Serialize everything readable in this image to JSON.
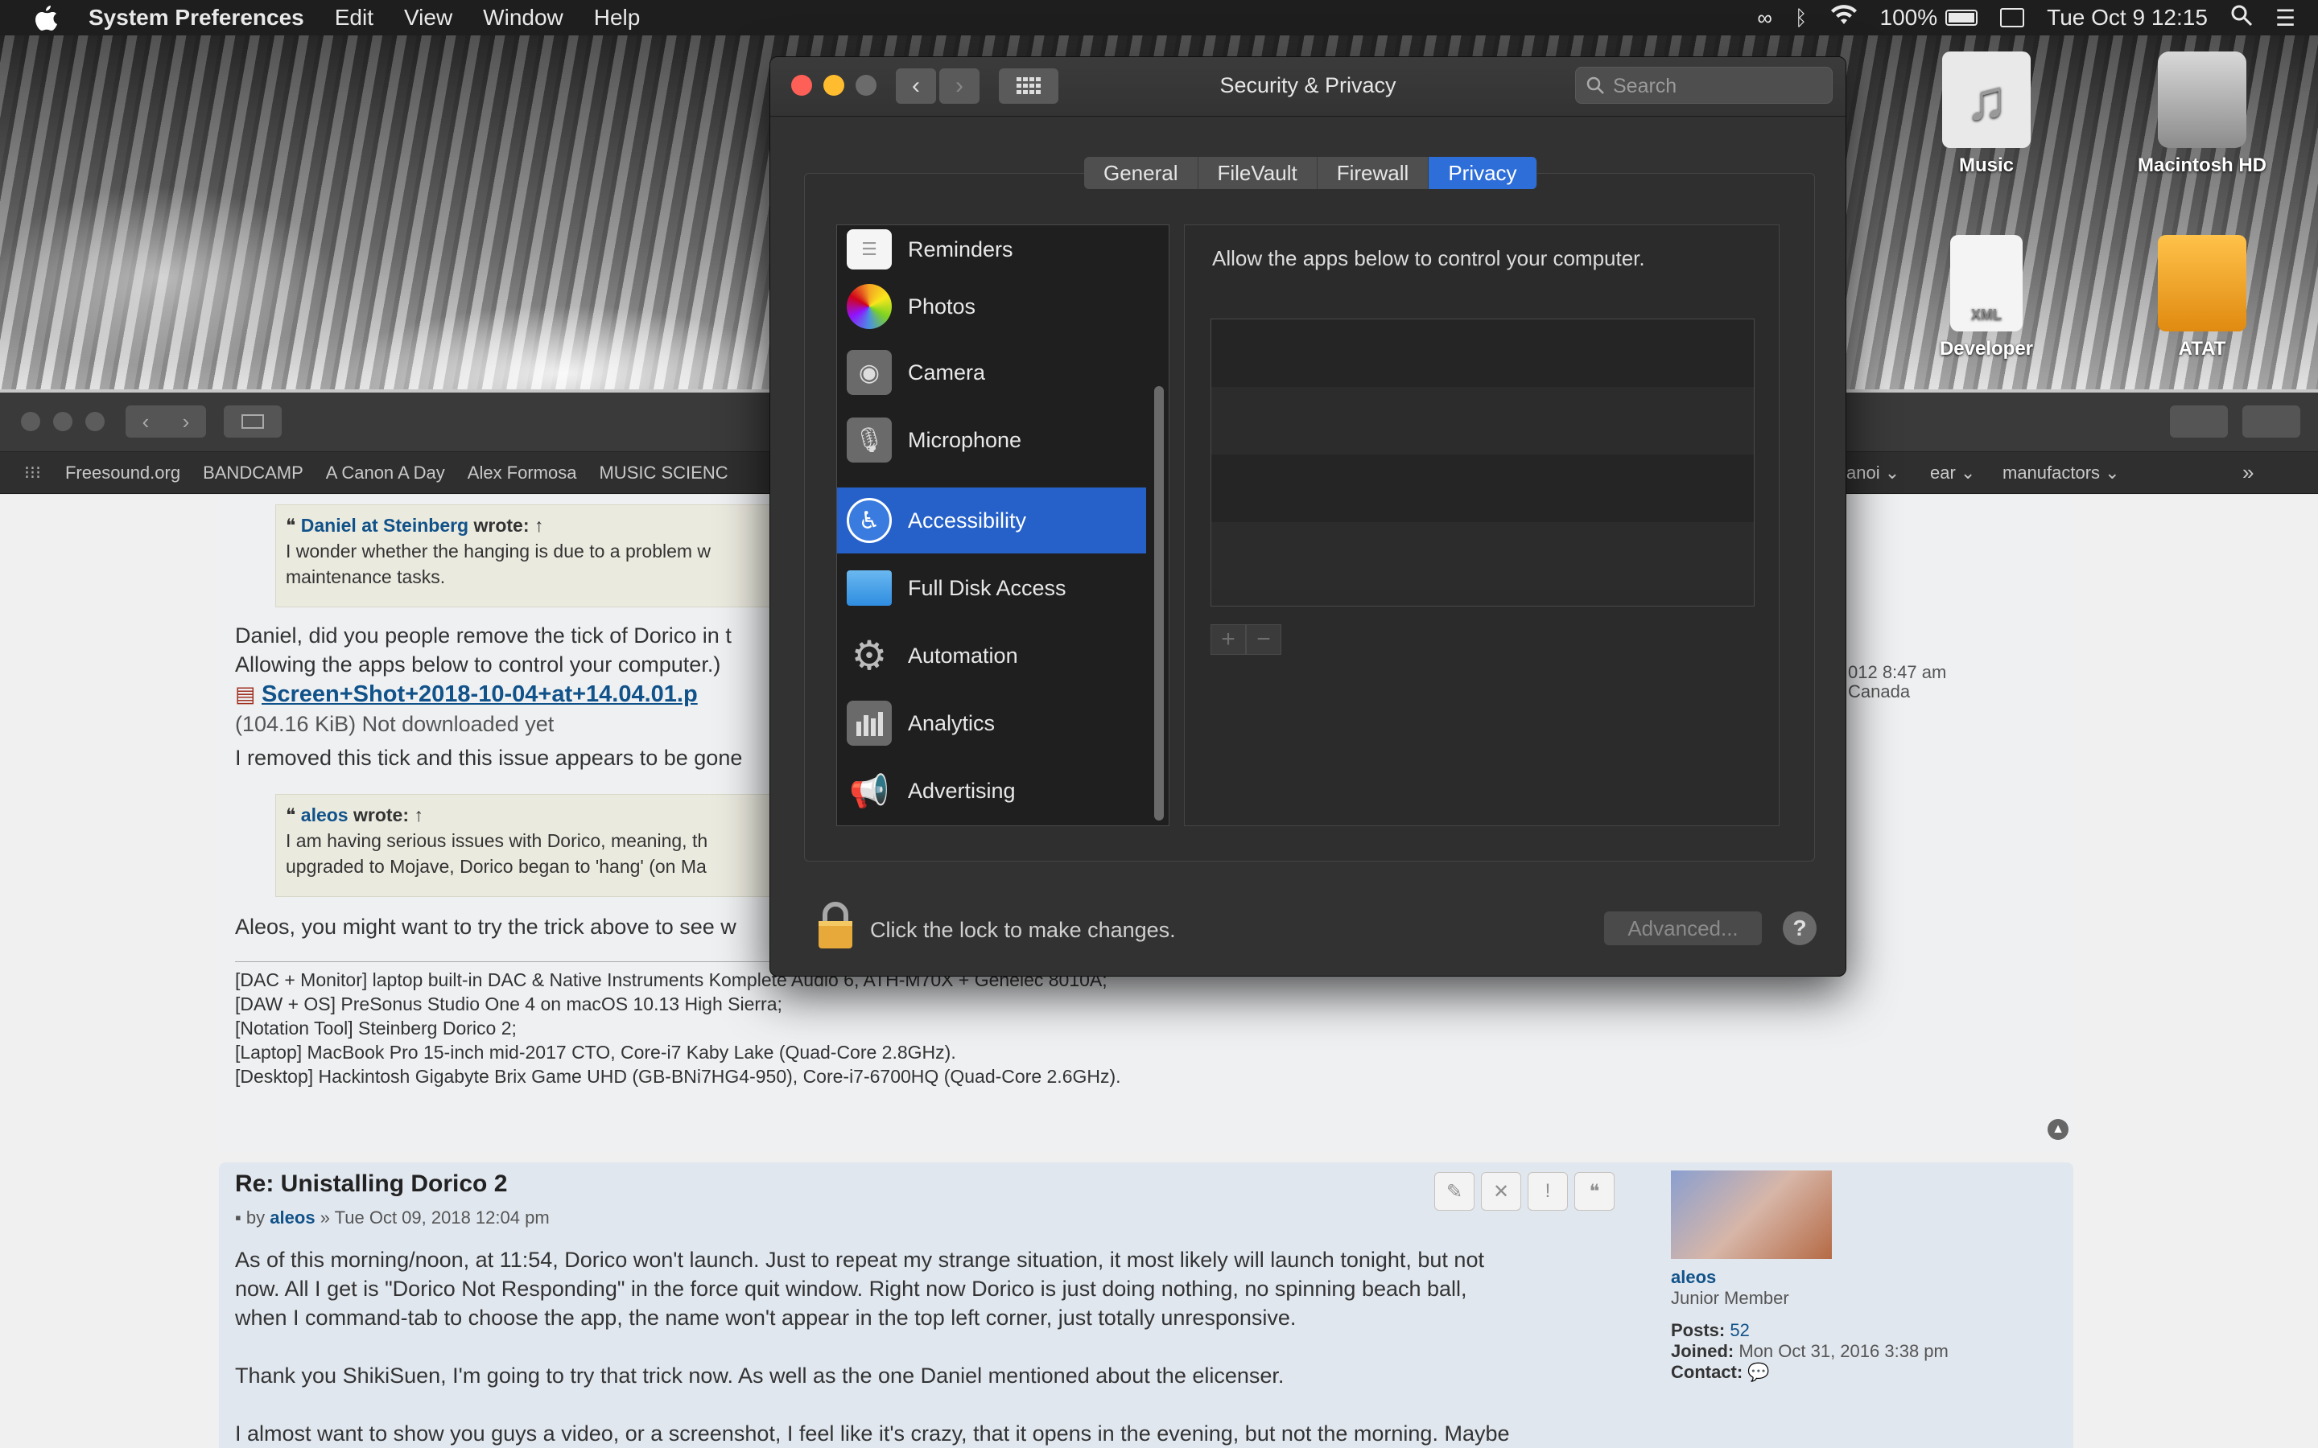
{
  "menubar": {
    "app_name": "System Preferences",
    "items": [
      "Edit",
      "View",
      "Window",
      "Help"
    ],
    "battery": "100%",
    "datetime": "Tue Oct 9  12:15"
  },
  "desktop": {
    "icons": [
      "Music",
      "Macintosh HD",
      "Developer",
      "ATAT"
    ],
    "xml_label": "XML"
  },
  "browser": {
    "bookmarks": [
      "Freesound.org",
      "BANDCAMP",
      "A Canon A Day",
      "Alex Formosa",
      "MUSIC SCIENC"
    ],
    "bookmarks_right": [
      "anoi ⌄",
      "ear ⌄",
      "manufactors ⌄"
    ],
    "post1": {
      "quote1_author": "Daniel at Steinberg",
      "quote1_wrote": "wrote: ↑",
      "quote1_line1": "I wonder whether the hanging is due to a problem w",
      "quote1_line2": "maintenance tasks.",
      "body1": "Daniel, did you people remove the tick of Dorico in t",
      "body2": "Allowing the apps below to control your computer.)",
      "attachment": "Screen+Shot+2018-10-04+at+14.04.01.p",
      "attachment_info": "(104.16 KiB) Not downloaded yet",
      "body3": "I removed this tick and this issue appears to be gone",
      "quote2_author": "aleos",
      "quote2_wrote": "wrote: ↑",
      "quote2_line1": "I am having serious issues with Dorico, meaning, th",
      "quote2_line2": "upgraded to Mojave, Dorico began to 'hang' (on Ma",
      "body4": "Aleos, you might want to try the trick above to see w",
      "sig1": "[DAC + Monitor] laptop built-in DAC & Native Instruments Komplete Audio 6, ATH-M70X + Genelec 8010A;",
      "sig2": "[DAW + OS] PreSonus Studio One 4 on macOS 10.13 High Sierra;",
      "sig3": "[Notation Tool] Steinberg Dorico 2;",
      "sig4": "[Laptop] MacBook Pro 15-inch mid-2017 CTO, Core-i7 Kaby Lake (Quad-Core 2.8GHz).",
      "sig5": "[Desktop] Hackintosh Gigabyte Brix Game UHD (GB-BNi7HG4-950), Core-i7-6700HQ (Quad-Core 2.6GHz).",
      "side_date": "012 8:47 am",
      "side_location": "Canada"
    },
    "post2": {
      "title": "Re: Unistalling Dorico 2",
      "by": "by",
      "author": "aleos",
      "date": "» Tue Oct 09, 2018 12:04 pm",
      "line1": "As of this morning/noon, at 11:54, Dorico won't launch. Just to repeat my strange situation, it most likely will launch tonight, but not",
      "line2": "now. All I get is \"Dorico Not Responding\" in the force quit window. Right now Dorico is just doing nothing, no spinning beach ball,",
      "line3": "when I command-tab to choose the app, the name won't appear in the top left corner, just totally unresponsive.",
      "line4": "Thank you ShikiSuen, I'm going to try that trick now. As well as the one Daniel mentioned about the elicenser.",
      "line5": "I almost want to show you guys a video, or a screenshot, I feel like it's crazy, that it opens in the evening, but not the morning. Maybe",
      "profile_name": "aleos",
      "profile_rank": "Junior Member",
      "posts_label": "Posts:",
      "posts_value": "52",
      "joined_label": "Joined:",
      "joined_value": "Mon Oct 31, 2016 3:38 pm",
      "contact_label": "Contact:"
    }
  },
  "prefs": {
    "title": "Security & Privacy",
    "search_placeholder": "Search",
    "tabs": [
      "General",
      "FileVault",
      "Firewall",
      "Privacy"
    ],
    "active_tab": "Privacy",
    "list": [
      "Reminders",
      "Photos",
      "Camera",
      "Microphone",
      "Accessibility",
      "Full Disk Access",
      "Automation",
      "Analytics",
      "Advertising"
    ],
    "selected": "Accessibility",
    "hint": "Allow the apps below to control your computer.",
    "add": "+",
    "remove": "−",
    "lock_text": "Click the lock to make changes.",
    "advanced": "Advanced...",
    "help": "?"
  },
  "colors": {
    "selection": "#2561c9",
    "active_tab": "#2e6ed8",
    "forum_link": "#105289"
  }
}
